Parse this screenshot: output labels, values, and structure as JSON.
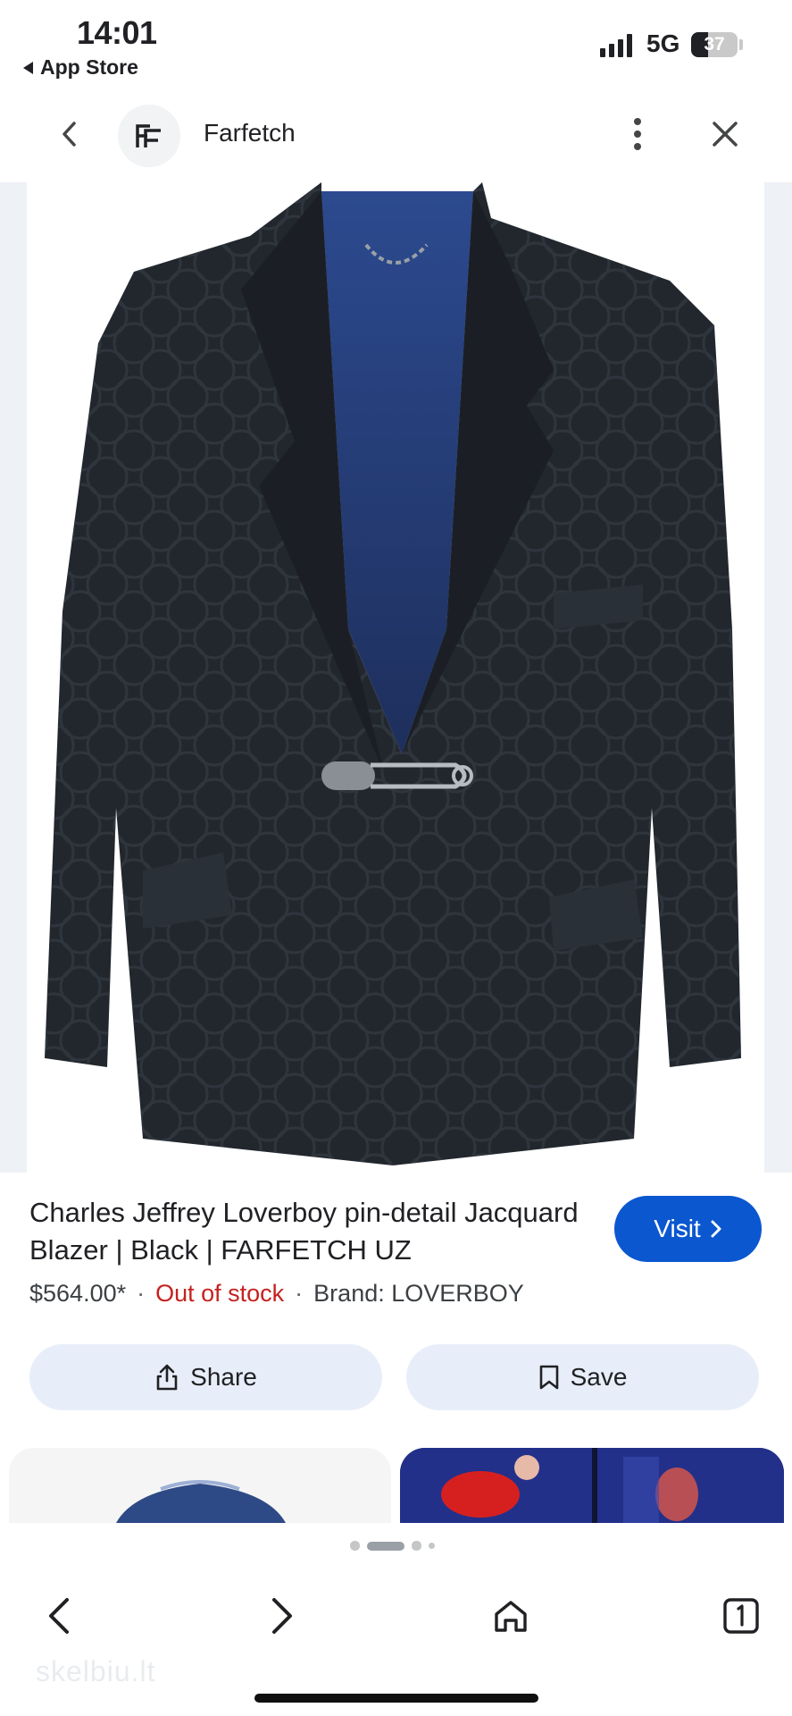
{
  "status_bar": {
    "time": "14:01",
    "back_label": "App Store",
    "network": "5G",
    "battery": "37",
    "battery_level": 0.37
  },
  "header": {
    "site_name": "Farfetch",
    "logo_text": "FF",
    "back_icon": "chevron-left-icon",
    "menu_icon": "more-vert-icon",
    "close_icon": "close-icon"
  },
  "product": {
    "title": "Charles Jeffrey Loverboy pin-detail Jacquard Blazer | Black | FARFETCH UZ",
    "price": "$564.00*",
    "separator": "·",
    "stock": "Out of stock",
    "brand": "Brand: LOVERBOY",
    "visit_label": "Visit"
  },
  "actions": {
    "share_label": "Share",
    "save_label": "Save"
  },
  "carousel": {
    "dots": 4,
    "active_index": 1
  },
  "watermark": "skelbiu.lt",
  "colors": {
    "accent": "#0b57d0",
    "out_of_stock": "#c5221f",
    "pill_bg": "#e8eef9"
  }
}
